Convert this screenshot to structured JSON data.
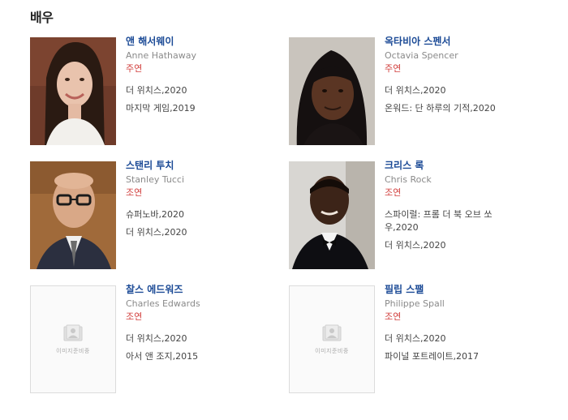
{
  "section_title": "배우",
  "actors": [
    {
      "name_ko": "앤 해서웨이",
      "name_en": "Anne Hathaway",
      "role": "주연",
      "works": [
        "더 위치스,2020",
        "마지막 게임,2019"
      ],
      "image_alt": ""
    },
    {
      "name_ko": "옥타비아 스펜서",
      "name_en": "Octavia Spencer",
      "role": "주연",
      "works": [
        "더 위치스,2020",
        "온워드: 단 하루의 기적,2020"
      ],
      "image_alt": ""
    },
    {
      "name_ko": "스탠리 투치",
      "name_en": "Stanley Tucci",
      "role": "조연",
      "works": [
        "슈퍼노바,2020",
        "더 위치스,2020"
      ],
      "image_alt": ""
    },
    {
      "name_ko": "크리스 록",
      "name_en": "Chris Rock",
      "role": "조연",
      "works": [
        "스파이럴: 프롬 더 북 오브 쏘우,2020",
        "더 위치스,2020"
      ],
      "image_alt": ""
    },
    {
      "name_ko": "찰스 에드워즈",
      "name_en": "Charles Edwards",
      "role": "조연",
      "works": [
        "더 위치스,2020",
        "아서 앤 조지,2015"
      ],
      "image_alt": "이미지준비중"
    },
    {
      "name_ko": "필립 스팰",
      "name_en": "Philippe Spall",
      "role": "조연",
      "works": [
        "더 위치스,2020",
        "파이널 포트레이트,2017"
      ],
      "image_alt": "이미지준비중"
    }
  ]
}
